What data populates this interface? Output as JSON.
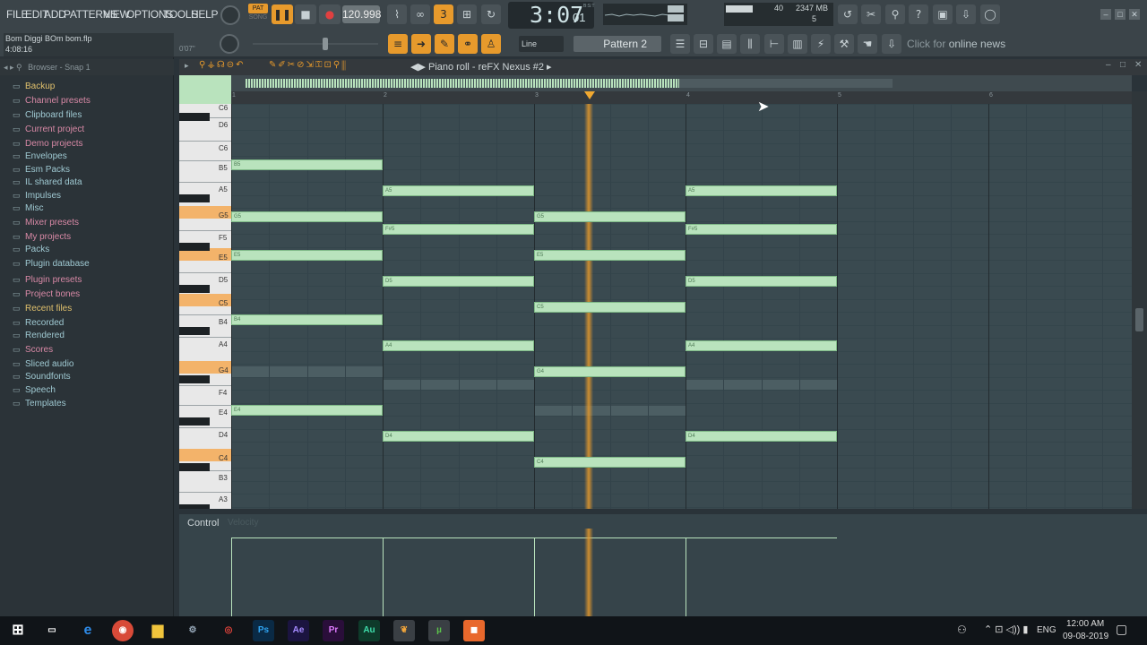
{
  "menu": [
    "FILE",
    "EDIT",
    "ADD",
    "PATTERNS",
    "VIEW",
    "OPTIONS",
    "TOOLS",
    "HELP"
  ],
  "transport": {
    "mode_label": "PAT",
    "mode_sub": "SONG",
    "tempo": "120.998",
    "time": "3:07",
    "time_ticks": "01",
    "time_unit": "B:S:T"
  },
  "project": {
    "file": "Bom Diggi BOm bom.flp",
    "duration": "4:08:16",
    "position": "0'07\""
  },
  "monitor": {
    "cpu": "40",
    "memory": "2347 MB",
    "polyphony": "5"
  },
  "toolbar": {
    "snap": "Line",
    "pattern": "Pattern 2",
    "news_prefix": "Click for",
    "news_label": "online news"
  },
  "browser": {
    "title": "Browser - Snap 1",
    "items": [
      {
        "label": "Backup",
        "icon": "folder-icon",
        "color": "#e0c06c"
      },
      {
        "label": "Channel presets",
        "icon": "folder-icon",
        "color": "#d889a6"
      },
      {
        "label": "Clipboard files",
        "icon": "folder-icon",
        "color": "#9fc9d2"
      },
      {
        "label": "Current project",
        "icon": "project-icon",
        "color": "#d889a6"
      },
      {
        "label": "Demo projects",
        "icon": "folder-icon",
        "color": "#d889a6"
      },
      {
        "label": "Envelopes",
        "icon": "folder-icon",
        "color": "#9fc9d2"
      },
      {
        "label": "Esm Packs",
        "icon": "folder-icon",
        "color": "#9fc9d2"
      },
      {
        "label": "IL shared data",
        "icon": "folder-icon",
        "color": "#9fc9d2"
      },
      {
        "label": "Impulses",
        "icon": "folder-icon",
        "color": "#9fc9d2"
      },
      {
        "label": "Misc",
        "icon": "folder-icon",
        "color": "#9fc9d2"
      },
      {
        "label": "Mixer presets",
        "icon": "folder-icon",
        "color": "#d889a6"
      },
      {
        "label": "My projects",
        "icon": "folder-icon",
        "color": "#d889a6"
      },
      {
        "label": "Packs",
        "icon": "folder-icon",
        "color": "#9fc9d2"
      },
      {
        "label": "Plugin database",
        "icon": "plugin-icon",
        "color": "#9fc9d2"
      },
      {
        "label": "Plugin presets",
        "icon": "folder-icon",
        "color": "#d889a6"
      },
      {
        "label": "Project bones",
        "icon": "folder-icon",
        "color": "#d889a6"
      },
      {
        "label": "Recent files",
        "icon": "folder-icon",
        "color": "#e0c06c"
      },
      {
        "label": "Recorded",
        "icon": "folder-icon",
        "color": "#9fc9d2"
      },
      {
        "label": "Rendered",
        "icon": "folder-icon",
        "color": "#9fc9d2"
      },
      {
        "label": "Scores",
        "icon": "score-icon",
        "color": "#d889a6"
      },
      {
        "label": "Sliced audio",
        "icon": "slice-icon",
        "color": "#9fc9d2"
      },
      {
        "label": "Soundfonts",
        "icon": "folder-icon",
        "color": "#9fc9d2"
      },
      {
        "label": "Speech",
        "icon": "speech-icon",
        "color": "#9fc9d2"
      },
      {
        "label": "Templates",
        "icon": "folder-icon",
        "color": "#9fc9d2"
      }
    ]
  },
  "piano_roll": {
    "title": "Piano roll - reFX Nexus #2",
    "bars": [
      "1",
      "2",
      "3",
      "4",
      "5",
      "6"
    ],
    "keys": [
      "C6",
      "D6",
      "C6",
      "B5",
      "A5",
      "G5",
      "F5",
      "E5",
      "D5",
      "C5",
      "B4",
      "A4",
      "G4",
      "F4",
      "E4",
      "D4",
      "C4",
      "B3",
      "A3"
    ],
    "notes": [
      {
        "label": "B5",
        "bar": 1
      },
      {
        "label": "G5",
        "bar": 1
      },
      {
        "label": "E5",
        "bar": 1
      },
      {
        "label": "B4",
        "bar": 1
      },
      {
        "label": "E4",
        "bar": 1
      },
      {
        "label": "A5",
        "bar": 2
      },
      {
        "label": "F#5",
        "bar": 2
      },
      {
        "label": "D5",
        "bar": 2
      },
      {
        "label": "A4",
        "bar": 2
      },
      {
        "label": "D4",
        "bar": 2
      },
      {
        "label": "G5",
        "bar": 3
      },
      {
        "label": "E5",
        "bar": 3
      },
      {
        "label": "C5",
        "bar": 3
      },
      {
        "label": "G4",
        "bar": 3
      },
      {
        "label": "C4",
        "bar": 3
      },
      {
        "label": "A5",
        "bar": 4
      },
      {
        "label": "F#5",
        "bar": 4
      },
      {
        "label": "D5",
        "bar": 4
      },
      {
        "label": "A4",
        "bar": 4
      },
      {
        "label": "D4",
        "bar": 4
      }
    ],
    "playhead_bar": 3.36,
    "control_label": "Control",
    "control_sub": "Velocity"
  },
  "taskbar": {
    "time": "12:00 AM",
    "date": "09-08-2019",
    "lang": "ENG"
  }
}
